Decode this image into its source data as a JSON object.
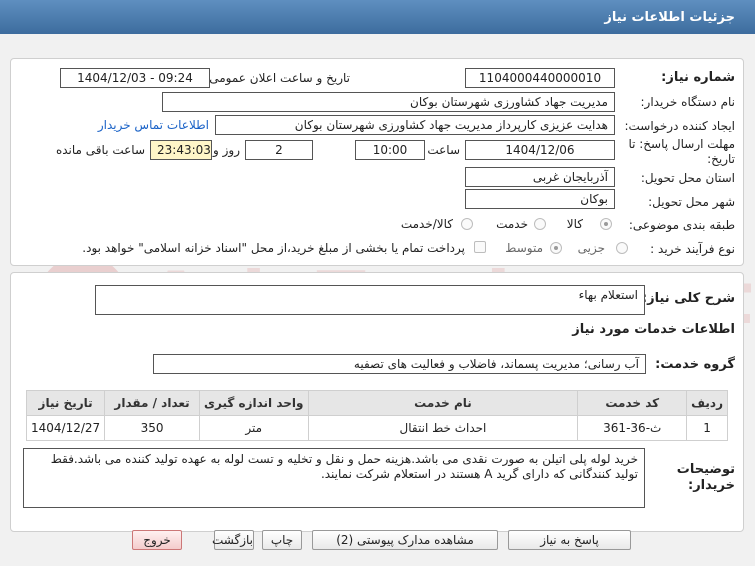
{
  "window_title": "جزئیات اطلاعات نیاز",
  "fields": {
    "need_number_label": "شماره نیاز:",
    "need_number": "1104000440000010",
    "announce_label": "تاریخ و ساعت اعلان عمومی:",
    "announce_value": "1404/12/03 - 09:24",
    "buyer_org_label": "نام دستگاه خریدار:",
    "buyer_org": "مدیریت جهاد کشاورزی شهرستان بوکان",
    "creator_label": "ایجاد کننده درخواست:",
    "creator": "هدایت عزیزی کارپرداز مدیریت جهاد کشاورزی شهرستان بوکان",
    "contact_link": "اطلاعات تماس خریدار",
    "deadline_label": "مهلت ارسال پاسخ: تا تاریخ:",
    "deadline_date": "1404/12/06",
    "hour_label": "ساعت",
    "deadline_time": "10:00",
    "day_label": "روز و",
    "days": "2",
    "remaining_time": "23:43:03",
    "remaining_label": "ساعت باقی مانده",
    "province_label": "استان محل تحویل:",
    "province": "آذربایجان غربی",
    "city_label": "شهر محل تحویل:",
    "city": "بوکان",
    "category_label": "طبقه بندی موضوعی:",
    "category_options": [
      "کالا",
      "خدمت",
      "کالا/خدمت"
    ],
    "process_label": "نوع فرآیند خرید :",
    "process_options": [
      "جزیی",
      "متوسط"
    ],
    "payment_note": "پرداخت تمام یا بخشی از مبلغ خرید،از محل \"اسناد خزانه اسلامی\" خواهد بود."
  },
  "need_summary": {
    "label": "شرح کلی نیاز:",
    "value": "استعلام بهاء"
  },
  "services_info": {
    "title": "اطلاعات خدمات مورد نیاز",
    "group_label": "گروه خدمت:",
    "group_value": "آب رسانی؛ مدیریت پسماند، فاضلاب و فعالیت های تصفیه",
    "table": {
      "headers": [
        "ردیف",
        "کد خدمت",
        "نام خدمت",
        "واحد اندازه گیری",
        "تعداد / مقدار",
        "تاریخ نیاز"
      ],
      "rows": [
        [
          "1",
          "ث-36-361",
          "احداث خط انتقال",
          "متر",
          "350",
          "1404/12/27"
        ]
      ]
    }
  },
  "buyer_notes": {
    "label": "توضیحات خریدار:",
    "value": "خرید لوله پلی اتیلن به صورت نقدی می باشد.هزینه حمل و نقل و تخلیه و تست لوله به عهده تولید کننده می باشد.فقط تولید کنندگانی که دارای گرید A هستند در استعلام شرکت نمایند."
  },
  "buttons": {
    "reply": "پاسخ به نیاز",
    "attachments": "مشاهده مدارک پیوستی (2)",
    "print": "چاپ",
    "back": "بازگشت",
    "exit": "خروج"
  },
  "watermark": "AriaTender.net",
  "colors": {
    "titlebar": "#4a7aad",
    "link": "#1a62c7",
    "highlight": "#fff6c8",
    "exit_button": "#f4cccc"
  }
}
